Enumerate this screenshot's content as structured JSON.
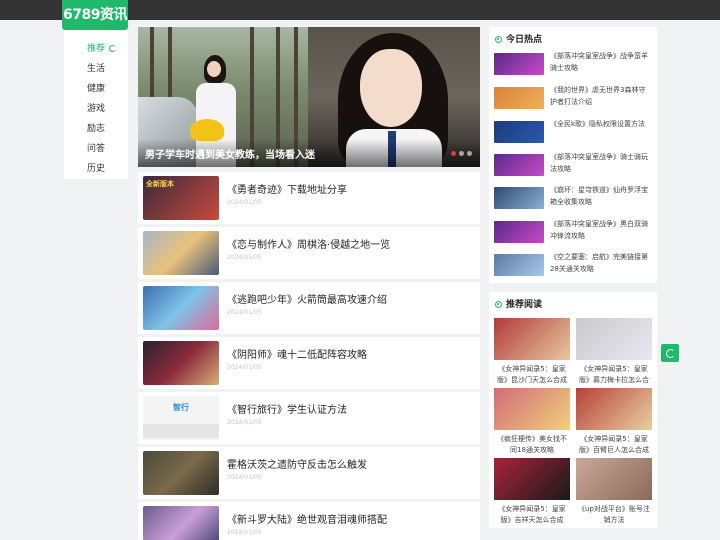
{
  "header": {
    "logo": "6789资讯"
  },
  "nav": {
    "items": [
      "推荐",
      "生活",
      "健康",
      "游戏",
      "励志",
      "问答",
      "历史"
    ],
    "active_index": 0
  },
  "hero": {
    "caption": "男子学车时遇到美女教练，当场看入迷",
    "slides": 3,
    "active_slide": 0
  },
  "articles": [
    {
      "title": "《勇者奇迹》下载地址分享",
      "date": "2024/01/05",
      "thumb_text": "全新版本",
      "thumb_color": "#3a2a3e"
    },
    {
      "title": "《恋与制作人》周棋洛·侵越之地一览",
      "date": "2024/01/05",
      "thumb_text": "",
      "thumb_color": "#a9b6c4"
    },
    {
      "title": "《逃跑吧少年》火箭筒最高攻速介绍",
      "date": "2024/01/05",
      "thumb_text": "",
      "thumb_color": "#3d6fb0"
    },
    {
      "title": "《阴阳师》魂十二低配阵容攻略",
      "date": "2024/01/05",
      "thumb_text": "",
      "thumb_color": "#2a2230"
    },
    {
      "title": "《智行旅行》学生认证方法",
      "date": "2024/01/05",
      "thumb_text": "智行",
      "thumb_color": "#f4f4f4"
    },
    {
      "title": "霍格沃茨之遗防守反击怎么触发",
      "date": "2024/01/05",
      "thumb_text": "",
      "thumb_color": "#4a4a3a"
    },
    {
      "title": "《新斗罗大陆》绝世观音泪魂师搭配",
      "date": "2024/01/05",
      "thumb_text": "",
      "thumb_color": "#6a5a8a"
    }
  ],
  "hot": {
    "heading": "今日热点",
    "items": [
      {
        "text": "《部落冲突皇室战争》战争蛮羊骑士攻略",
        "color": "#8b3aa8"
      },
      {
        "text": "《我的世界》虐无世界3森林守护者打法介绍",
        "color": "#d9833a"
      },
      {
        "text": "《全民k歌》隐私权限设置方法",
        "color": "#1d3a7a"
      },
      {
        "text": "《部落冲突皇室战争》骑士骑玩法攻略",
        "color": "#8b3aa8"
      },
      {
        "text": "《崩坏：星穹铁道》仙舟罗浮宝箱全收集攻略",
        "color": "#2d4a6e"
      },
      {
        "text": "《部落冲突皇室战争》黑白双骑冲锋流攻略",
        "color": "#8b3aa8"
      },
      {
        "text": "《空之要塞：启航》完美链接第28关通关攻略",
        "color": "#5a7aa8"
      }
    ]
  },
  "recommend": {
    "heading": "推荐阅读",
    "items": [
      {
        "text": "《女神异闻录5：皇家版》昆沙门天怎么合成",
        "color": "#b23a3a"
      },
      {
        "text": "《女神异闻录5：皇家版》慕力梅卡拉怎么合",
        "color": "#c9c9cf"
      },
      {
        "text": "《疯狂梗传》美女找不同18通关攻略",
        "color": "#d36b7a"
      },
      {
        "text": "《女神异闻录5：皇家版》百臂巨人怎么合成",
        "color": "#b8403a"
      },
      {
        "text": "《女神异闻录5：皇家版》吉祥天怎么合成",
        "color": "#a8233a"
      },
      {
        "text": "《up对战平台》账号注销方法",
        "color": "#c9a89a"
      }
    ]
  },
  "colors": {
    "accent": "#1fb96b",
    "topbar": "#333333",
    "page_bg": "#f1f2f4"
  }
}
